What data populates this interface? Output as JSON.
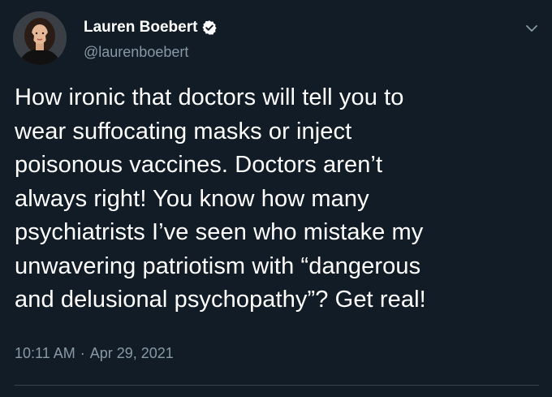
{
  "tweet": {
    "author": {
      "display_name": "Lauren Boebert",
      "handle": "@laurenboebert",
      "verified": true,
      "avatar_icon": "profile-photo"
    },
    "menu_icon": "chevron-down-icon",
    "text_lines": [
      "How ironic that doctors will tell you to",
      "wear suffocating masks or inject",
      "poisonous vaccines. Doctors aren’t",
      "always right! You know how many",
      "psychiatrists I’ve seen who mistake my",
      "unwavering patriotism with “dangerous",
      "and delusional psychopathy”? Get real!"
    ],
    "time": "10:11 AM",
    "separator": "·",
    "date": "Apr 29, 2021"
  },
  "colors": {
    "background": "#121c26",
    "text": "#ffffff",
    "secondary_text": "#8899a6",
    "verified_badge": "#ffffff",
    "divider": "#38444d"
  }
}
